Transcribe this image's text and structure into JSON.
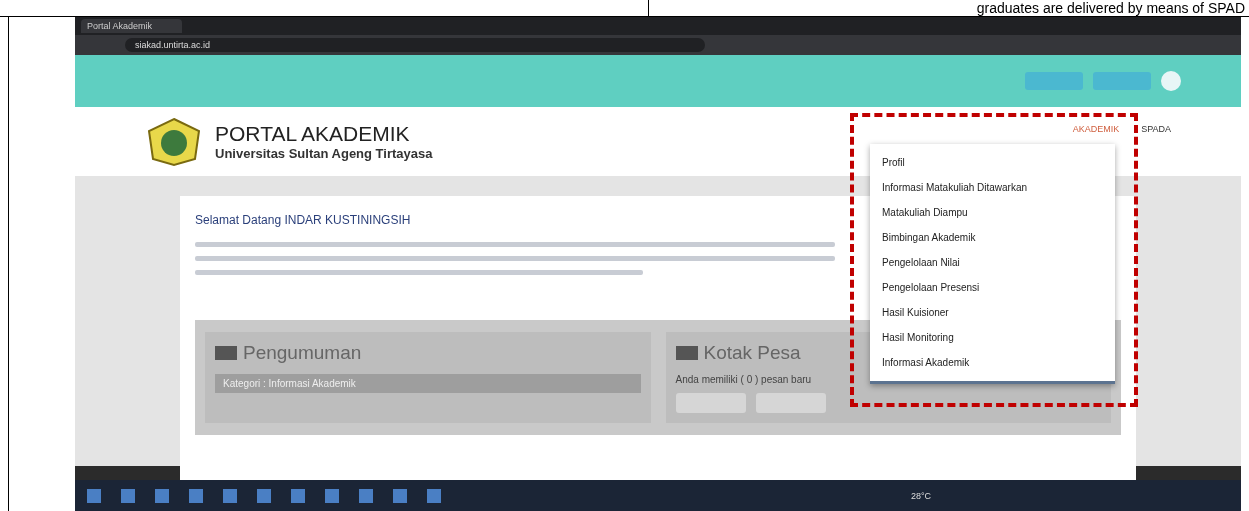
{
  "document": {
    "caption": "graduates are delivered by means of SPAD"
  },
  "browser": {
    "tab": {
      "title": "Portal Akademik"
    },
    "address": "siakad.untirta.ac.id"
  },
  "portal": {
    "title": "PORTAL AKADEMIK",
    "subtitle": "Universitas Sultan Ageng Tirtayasa",
    "nav": [
      {
        "label": "AKADEMIK",
        "selected": true
      },
      {
        "label": "SPADA",
        "selected": false
      }
    ],
    "menu": [
      "Profil",
      "Informasi Matakuliah Ditawarkan",
      "Matakuliah Diampu",
      "Bimbingan Akademik",
      "Pengelolaan Nilai",
      "Pengelolaan Presensi",
      "Hasil Kuisioner",
      "Hasil Monitoring",
      "Informasi Akademik"
    ],
    "welcome": "Selamat Datang INDAR KUSTININGSIH",
    "announcements": {
      "title": "Pengumuman",
      "category": "Kategori : Informasi Akademik"
    },
    "inbox": {
      "title": "Kotak Pesa",
      "message": "Anda memiliki ( 0 ) pesan baru"
    }
  },
  "taskbar": {
    "weather": "28°C"
  }
}
